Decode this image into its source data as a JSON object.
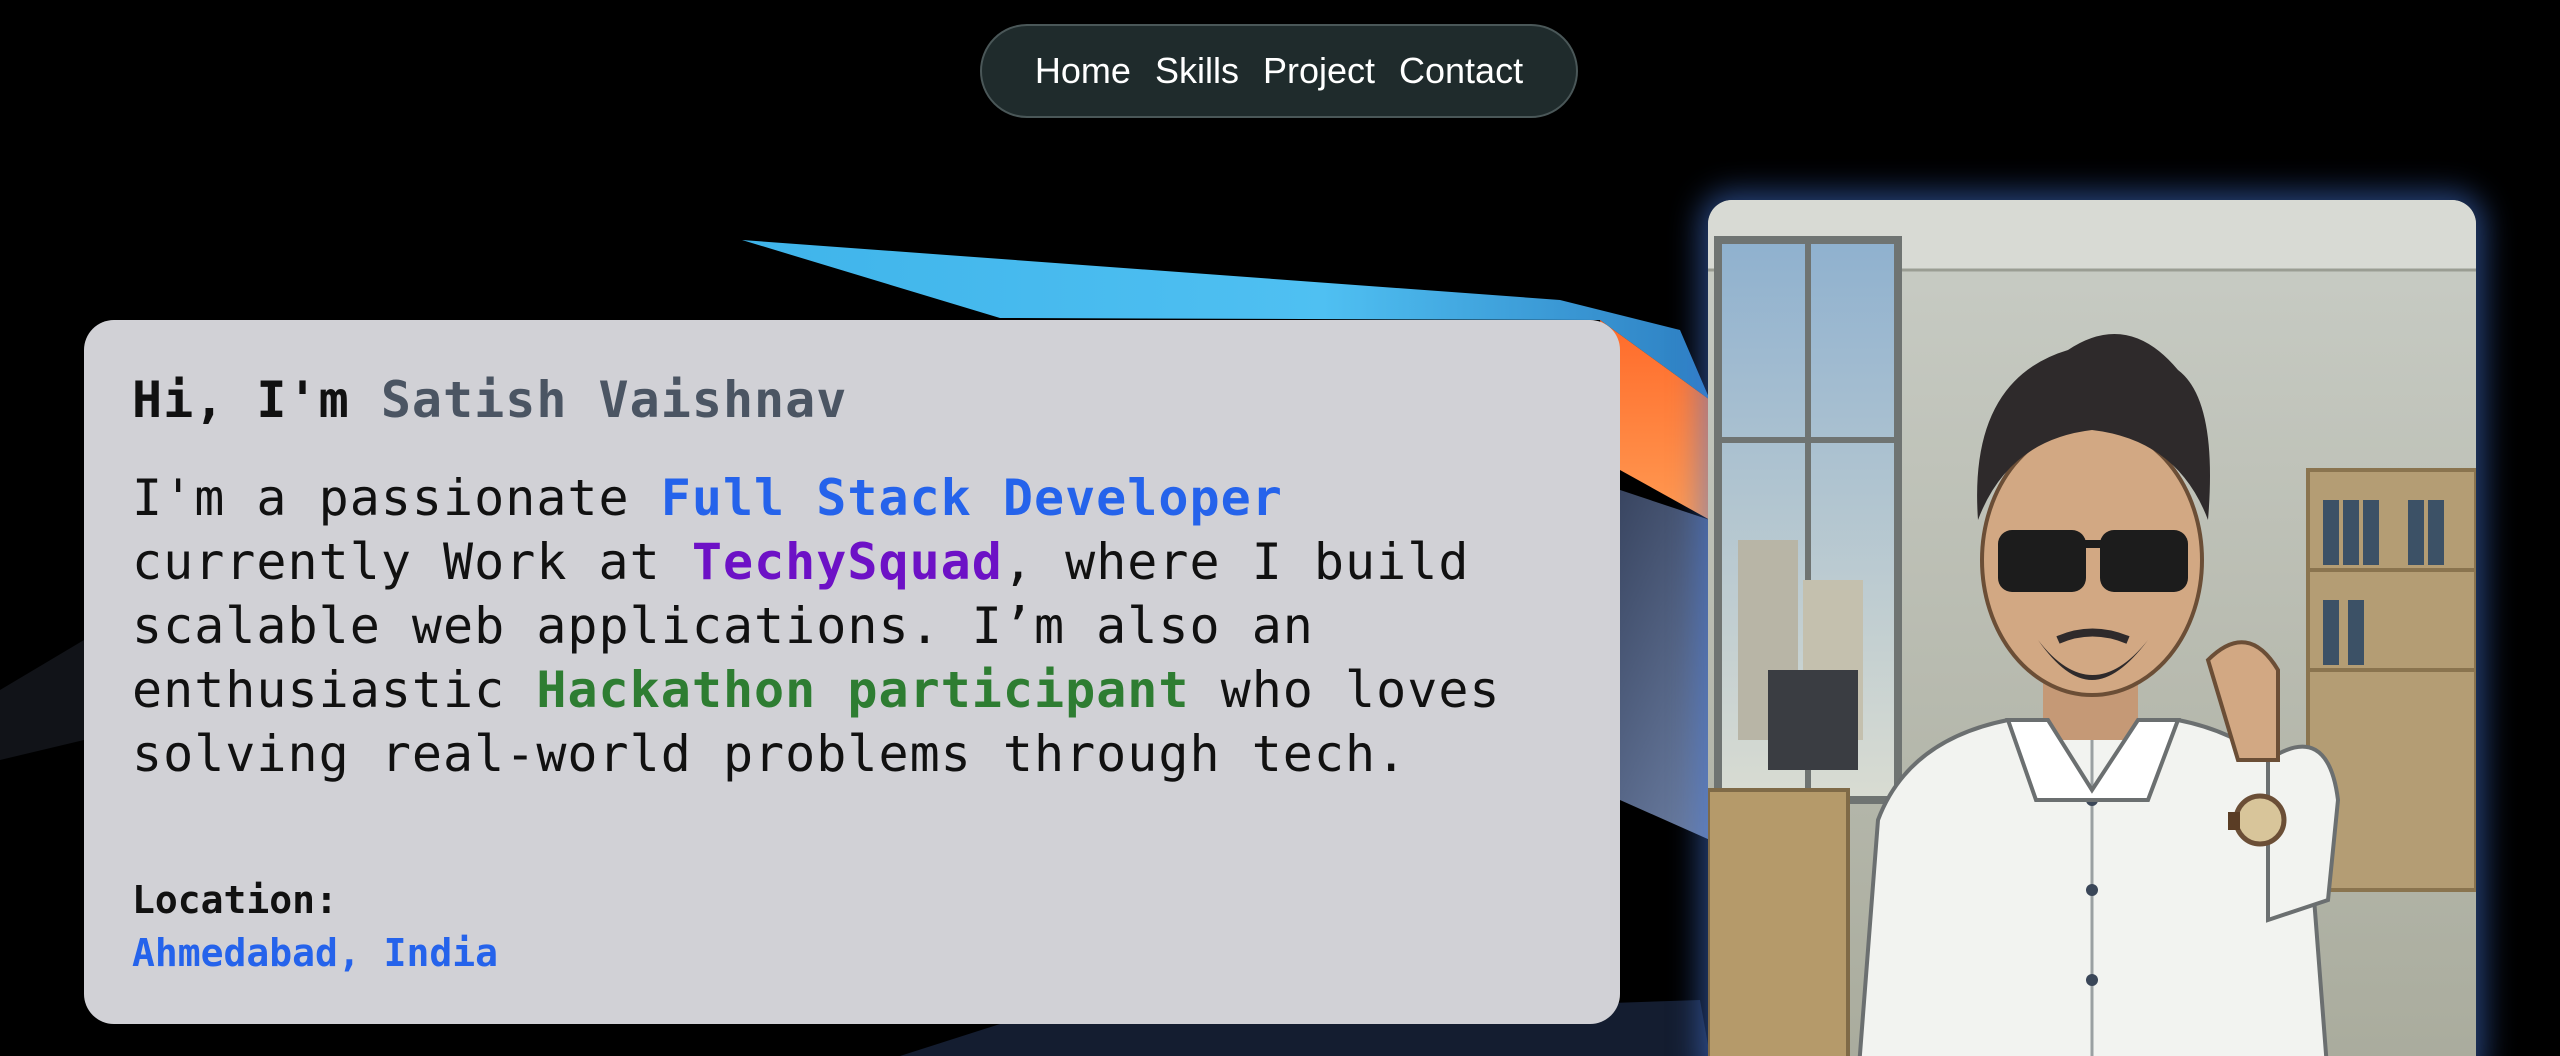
{
  "nav": {
    "items": [
      {
        "label": "Home"
      },
      {
        "label": "Skills"
      },
      {
        "label": "Project"
      },
      {
        "label": "Contact"
      }
    ]
  },
  "intro": {
    "greeting_prefix": "Hi, I'm",
    "name": "Satish Vaishnav",
    "bio": {
      "part1": "I'm a passionate ",
      "role": "Full Stack Developer",
      "part2": " currently Work at ",
      "company": "TechySquad",
      "part3": ", where I build scalable web applications. I’m also an enthusiastic ",
      "hackathon": "Hackathon participant",
      "part4": " who loves solving real-world problems through tech."
    },
    "location_label": "Location:",
    "location_value": "Ahmedabad, India"
  },
  "colors": {
    "background": "#000000",
    "card": "#d1d1d6",
    "accent_blue": "#2563eb",
    "accent_purple": "#6d11c6",
    "accent_green": "#2e7d32",
    "name_gray": "#4b5563",
    "nav_bg": "#1f2b2c"
  },
  "portrait": {
    "icon": "developer-portrait-illustration"
  }
}
